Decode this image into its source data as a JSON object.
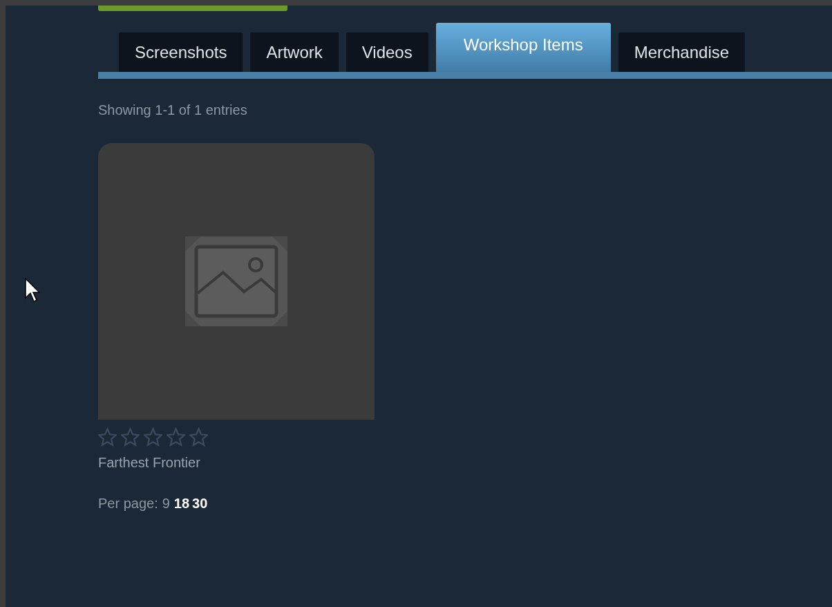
{
  "tabs": [
    {
      "label": "Screenshots",
      "selected": false
    },
    {
      "label": "Artwork",
      "selected": false
    },
    {
      "label": "Videos",
      "selected": false
    },
    {
      "label": "Workshop Items",
      "selected": true
    },
    {
      "label": "Merchandise",
      "selected": false
    }
  ],
  "summary": "Showing 1-1 of 1 entries",
  "items": [
    {
      "title": "Farthest Frontier",
      "stars": 0
    }
  ],
  "per_page": {
    "label": "Per page:",
    "options": [
      {
        "label": "9",
        "selected": true
      },
      {
        "label": "18",
        "selected": false
      },
      {
        "label": "30",
        "selected": false
      }
    ]
  }
}
